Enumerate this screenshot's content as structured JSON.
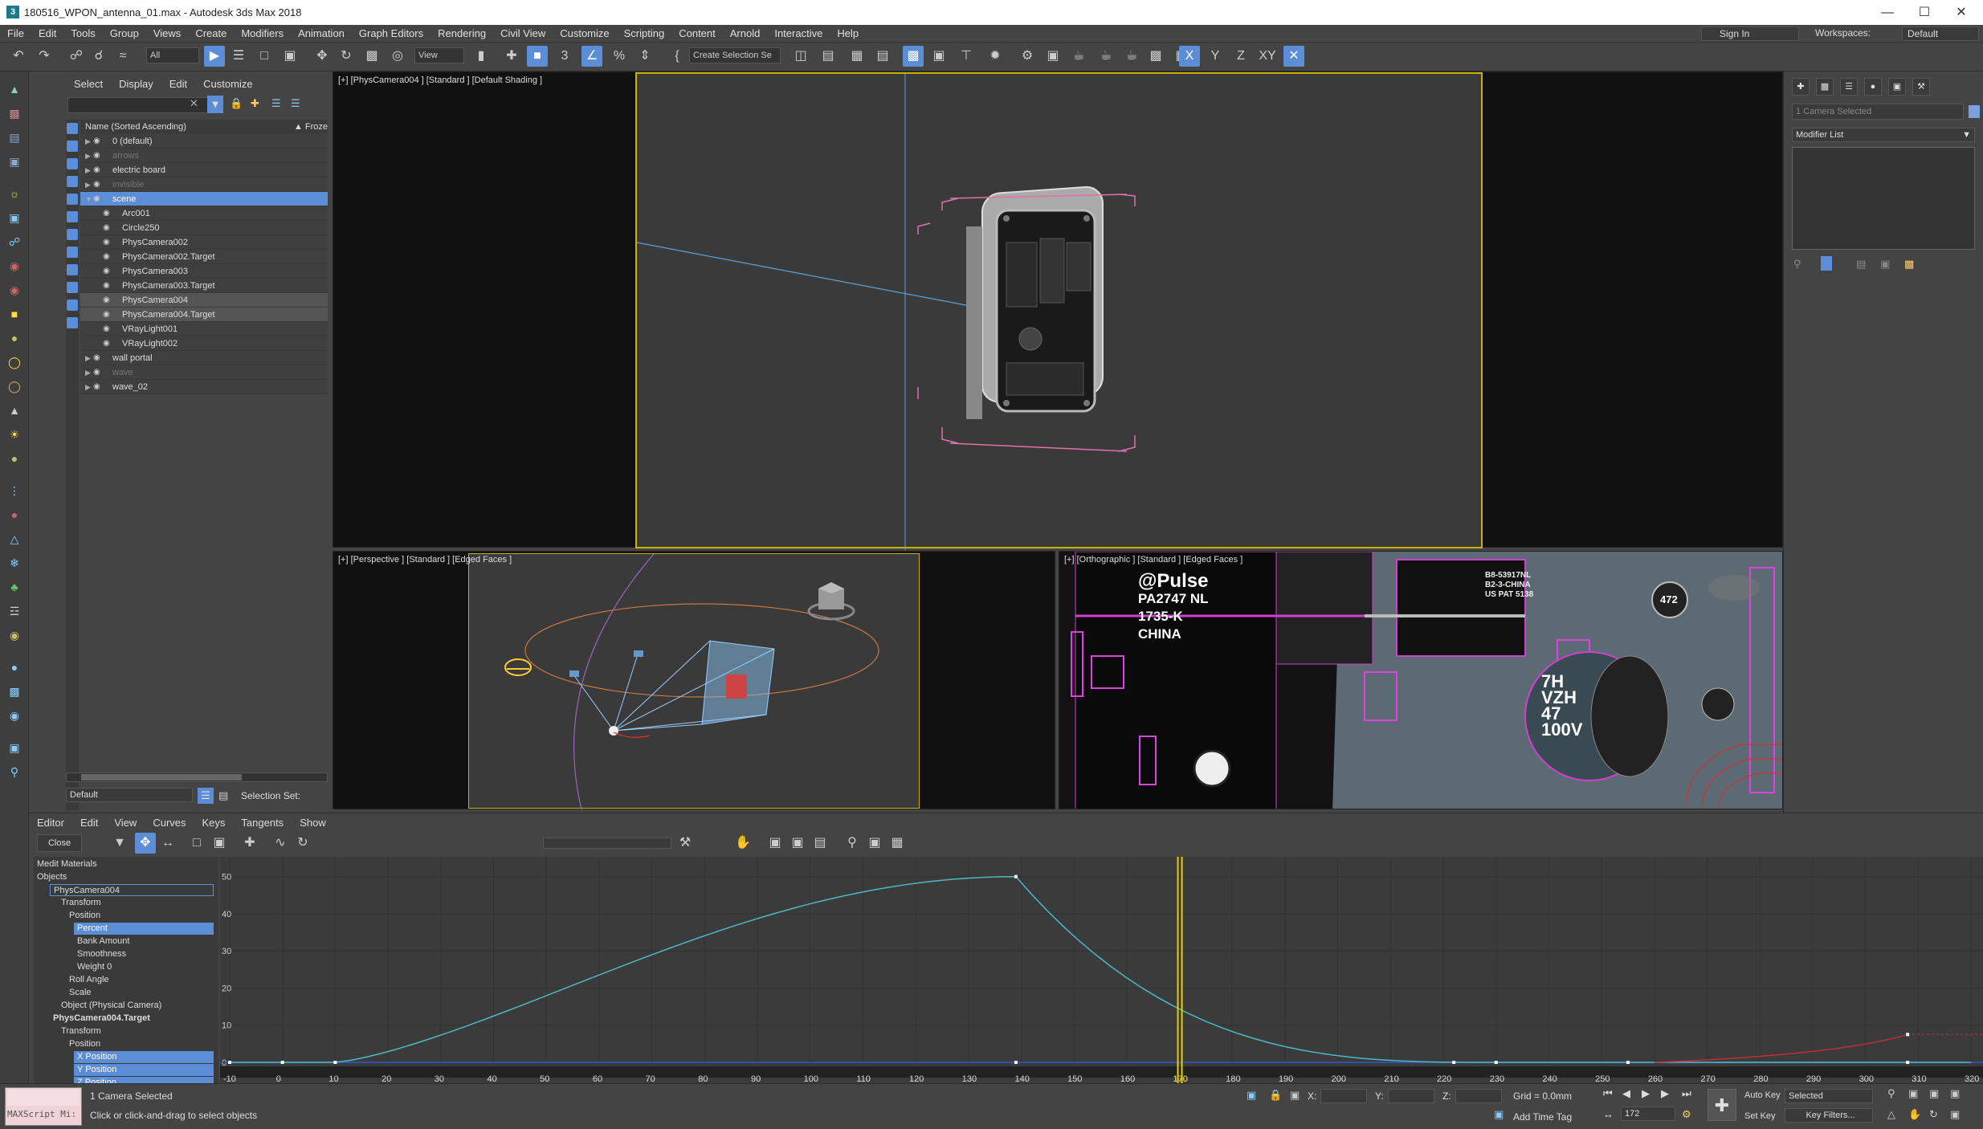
{
  "window": {
    "title": "180516_WPON_antenna_01.max - Autodesk 3ds Max 2018",
    "app_icon": "3"
  },
  "menu": [
    "File",
    "Edit",
    "Tools",
    "Group",
    "Views",
    "Create",
    "Modifiers",
    "Animation",
    "Graph Editors",
    "Rendering",
    "Civil View",
    "Customize",
    "Scripting",
    "Content",
    "Arnold",
    "Interactive",
    "Help"
  ],
  "account": {
    "sign_in": "Sign In",
    "workspaces_label": "Workspaces:",
    "workspace": "Default"
  },
  "toolbar": {
    "filter": "All",
    "ref_coord": "View",
    "selection_set": "Create Selection Se",
    "axes": [
      "X",
      "Y",
      "Z",
      "XY"
    ]
  },
  "scene_explorer": {
    "tabs": [
      "Select",
      "Display",
      "Edit",
      "Customize"
    ],
    "header_name": "Name (Sorted Ascending)",
    "header_frozen": "▲ Froze",
    "rows": [
      {
        "name": "0 (default)",
        "level": 0,
        "state": "normal"
      },
      {
        "name": "arrows",
        "level": 0,
        "state": "dim"
      },
      {
        "name": "electric board",
        "level": 0,
        "state": "normal"
      },
      {
        "name": "invisible",
        "level": 0,
        "state": "dim"
      },
      {
        "name": "scene",
        "level": 0,
        "state": "highlight"
      },
      {
        "name": "Arc001",
        "level": 1,
        "state": "normal"
      },
      {
        "name": "Circle250",
        "level": 1,
        "state": "normal"
      },
      {
        "name": "PhysCamera002",
        "level": 1,
        "state": "normal"
      },
      {
        "name": "PhysCamera002.Target",
        "level": 1,
        "state": "normal"
      },
      {
        "name": "PhysCamera003",
        "level": 1,
        "state": "normal"
      },
      {
        "name": "PhysCamera003.Target",
        "level": 1,
        "state": "normal"
      },
      {
        "name": "PhysCamera004",
        "level": 1,
        "state": "selected"
      },
      {
        "name": "PhysCamera004.Target",
        "level": 1,
        "state": "selected"
      },
      {
        "name": "VRayLight001",
        "level": 1,
        "state": "normal"
      },
      {
        "name": "VRayLight002",
        "level": 1,
        "state": "normal"
      },
      {
        "name": "wall portal",
        "level": 0,
        "state": "normal"
      },
      {
        "name": "wave",
        "level": 0,
        "state": "dim"
      },
      {
        "name": "wave_02",
        "level": 0,
        "state": "normal"
      }
    ],
    "layer": "Default",
    "selection_set_label": "Selection Set:"
  },
  "viewports": {
    "top": "[+] [PhysCamera004 ] [Standard ] [Default Shading ]",
    "perspective": "[+] [Perspective ] [Standard ] [Edged Faces ]",
    "ortho": "[+] [Orthographic ] [Standard ] [Edged Faces ]",
    "chip_text": [
      "@Pulse",
      "PA2747 NL",
      "1735-K",
      "CHINA"
    ],
    "cap_text": [
      "7H",
      "VZH",
      "47",
      "100V"
    ],
    "chip2_text": [
      "B8-53917NL",
      "B2-3-CHINA",
      "US PAT 5138"
    ],
    "cap_small": "472"
  },
  "command_panel": {
    "name_field": "1 Camera Selected",
    "modifier_list": "Modifier List"
  },
  "track_view": {
    "menu": [
      "Editor",
      "Edit",
      "View",
      "Curves",
      "Keys",
      "Tangents",
      "Show"
    ],
    "close": "Close",
    "tree": [
      {
        "label": "Medit Materials",
        "indent": 0,
        "state": "normal"
      },
      {
        "label": "Objects",
        "indent": 0,
        "state": "normal"
      },
      {
        "label": "PhysCamera004",
        "indent": 2,
        "state": "box"
      },
      {
        "label": "Transform",
        "indent": 3,
        "state": "normal"
      },
      {
        "label": "Position",
        "indent": 4,
        "state": "normal"
      },
      {
        "label": "Percent",
        "indent": 5,
        "state": "highlight"
      },
      {
        "label": "Bank Amount",
        "indent": 5,
        "state": "normal"
      },
      {
        "label": "Smoothness",
        "indent": 5,
        "state": "normal"
      },
      {
        "label": "Weight 0",
        "indent": 5,
        "state": "normal"
      },
      {
        "label": "Roll Angle",
        "indent": 4,
        "state": "normal"
      },
      {
        "label": "Scale",
        "indent": 4,
        "state": "normal"
      },
      {
        "label": "Object (Physical Camera)",
        "indent": 3,
        "state": "normal"
      },
      {
        "label": "PhysCamera004.Target",
        "indent": 2,
        "state": "bold"
      },
      {
        "label": "Transform",
        "indent": 3,
        "state": "normal"
      },
      {
        "label": "Position",
        "indent": 4,
        "state": "normal"
      },
      {
        "label": "X Position",
        "indent": 5,
        "state": "highlight"
      },
      {
        "label": "Y Position",
        "indent": 5,
        "state": "highlight"
      },
      {
        "label": "Z Position",
        "indent": 5,
        "state": "highlight"
      }
    ],
    "y_ticks": [
      "50",
      "40",
      "30",
      "20",
      "10",
      "0"
    ],
    "x_ticks": [
      "-10",
      "0",
      "10",
      "20",
      "30",
      "40",
      "50",
      "60",
      "70",
      "80",
      "90",
      "100",
      "110",
      "120",
      "130",
      "140",
      "150",
      "160",
      "170",
      "180",
      "190",
      "200",
      "210",
      "220",
      "230",
      "240",
      "250",
      "260",
      "270",
      "280",
      "290",
      "300",
      "310",
      "320"
    ],
    "current_frame": "170"
  },
  "status": {
    "selected": "1 Camera Selected",
    "prompt": "Click or click-and-drag to select objects",
    "maxscript": "MAXScript Mi:",
    "x_label": "X:",
    "y_label": "Y:",
    "z_label": "Z:",
    "grid": "Grid = 0.0mm",
    "add_time_tag": "Add Time Tag",
    "auto_key": "Auto Key",
    "set_key": "Set Key",
    "selected_filter": "Selected",
    "key_filters": "Key Filters...",
    "frame": "172"
  }
}
